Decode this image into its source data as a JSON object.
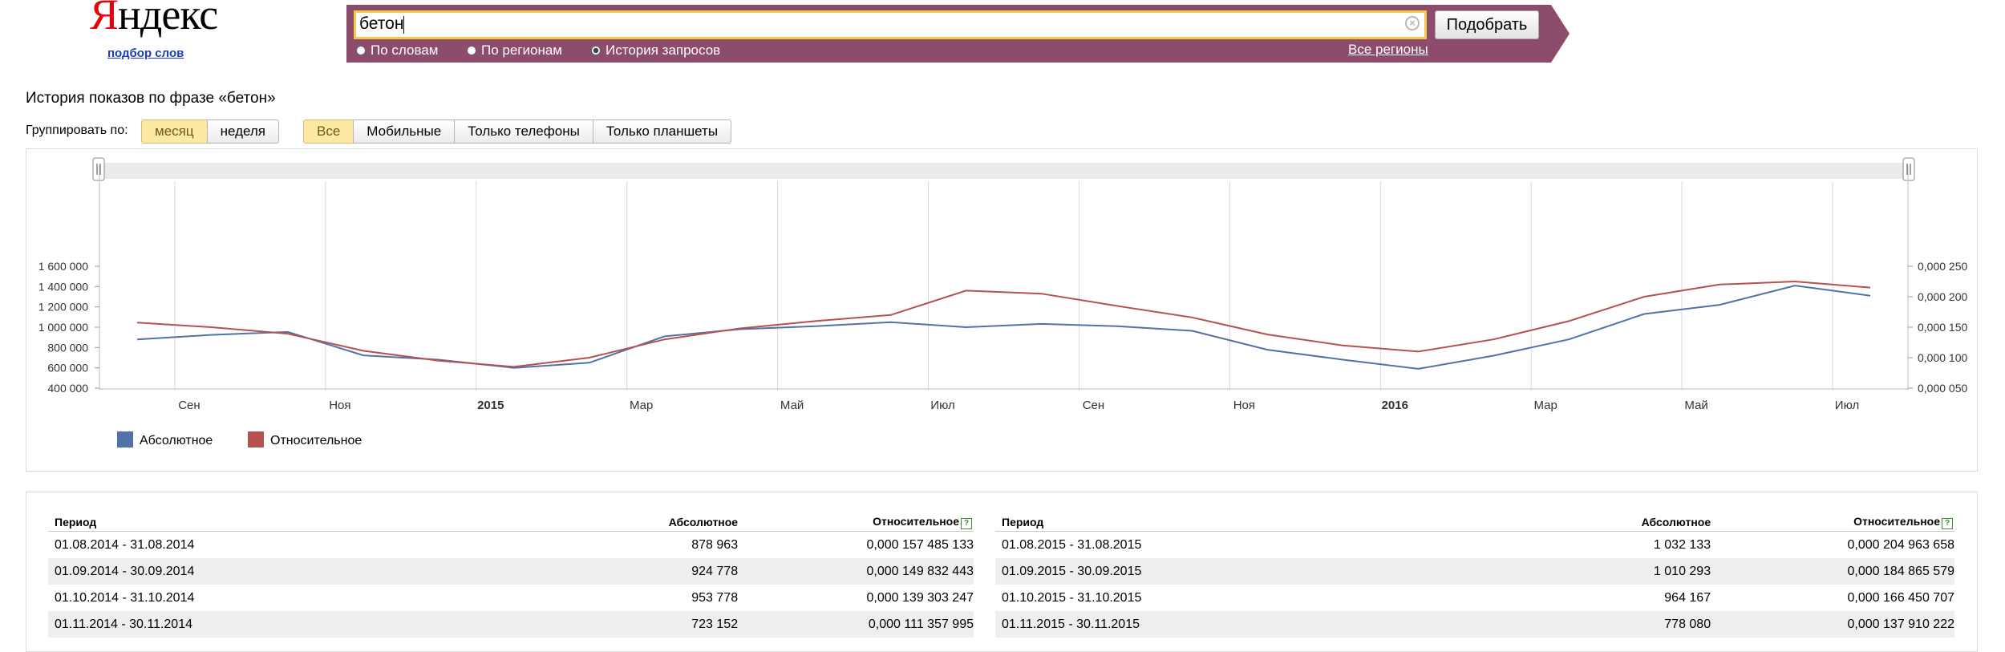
{
  "logo": {
    "text_first": "Я",
    "text_rest": "ндекс",
    "sub": "подбор слов"
  },
  "search": {
    "value": "бетон",
    "button": "Подобрать",
    "modes": [
      {
        "label": "По словам",
        "selected": false
      },
      {
        "label": "По регионам",
        "selected": false
      },
      {
        "label": "История запросов",
        "selected": true
      }
    ],
    "regions_link": "Все регионы"
  },
  "page_title": "История показов по фразе «бетон»",
  "grouping": {
    "label": "Группировать по:",
    "options": [
      "месяц",
      "неделя"
    ],
    "active": 0
  },
  "devices": {
    "options": [
      "Все",
      "Мобильные",
      "Только телефоны",
      "Только планшеты"
    ],
    "active": 0
  },
  "colors": {
    "absolute": "#4f73a6",
    "relative": "#b5524f",
    "accent": "#8e4c6c",
    "highlight": "#f3c94b"
  },
  "chart_data": {
    "type": "line",
    "x": [
      "2014-08",
      "2014-09",
      "2014-10",
      "2014-11",
      "2014-12",
      "2015-01",
      "2015-02",
      "2015-03",
      "2015-04",
      "2015-05",
      "2015-06",
      "2015-07",
      "2015-08",
      "2015-09",
      "2015-10",
      "2015-11",
      "2015-12",
      "2016-01",
      "2016-02",
      "2016-03",
      "2016-04",
      "2016-05",
      "2016-06",
      "2016-07"
    ],
    "x_tick_labels": [
      "Сен",
      "Ноя",
      "2015",
      "Мар",
      "Май",
      "Июл",
      "Сен",
      "Ноя",
      "2016",
      "Мар",
      "Май",
      "Июл"
    ],
    "y_left_ticks": [
      "400 000",
      "600 000",
      "800 000",
      "1 000 000",
      "1 200 000",
      "1 400 000",
      "1 600 000"
    ],
    "y_right_ticks": [
      "0,000 050",
      "0,000 100",
      "0,000 150",
      "0,000 200",
      "0,000 250"
    ],
    "ylim_left": [
      400000,
      1600000
    ],
    "ylim_right": [
      5e-05,
      0.00025
    ],
    "grid": "vertical",
    "legend_position": "bottom-left",
    "series": [
      {
        "name": "Абсолютное",
        "axis": "left",
        "values": [
          878963,
          924778,
          953778,
          723152,
          680000,
          600000,
          650000,
          910000,
          980000,
          1010000,
          1050000,
          1000000,
          1032133,
          1010293,
          964167,
          778080,
          680000,
          590000,
          720000,
          880000,
          1130000,
          1220000,
          1410000,
          1310000
        ]
      },
      {
        "name": "Относительное",
        "axis": "right",
        "values": [
          0.000157485,
          0.000149832,
          0.000139303,
          0.000111358,
          9.5e-05,
          8.5e-05,
          0.0001,
          0.00013,
          0.000148,
          0.00016,
          0.00017,
          0.00021,
          0.000205,
          0.000185,
          0.000166,
          0.000138,
          0.00012,
          0.00011,
          0.00013,
          0.00016,
          0.0002,
          0.00022,
          0.000225,
          0.000215
        ]
      }
    ]
  },
  "table": {
    "headers": {
      "period": "Период",
      "absolute": "Абсолютное",
      "relative": "Относительное",
      "help": "?"
    },
    "left": [
      {
        "period": "01.08.2014 - 31.08.2014",
        "absolute": "878 963",
        "relative": "0,000 157 485 133"
      },
      {
        "period": "01.09.2014 - 30.09.2014",
        "absolute": "924 778",
        "relative": "0,000 149 832 443"
      },
      {
        "period": "01.10.2014 - 31.10.2014",
        "absolute": "953 778",
        "relative": "0,000 139 303 247"
      },
      {
        "period": "01.11.2014 - 30.11.2014",
        "absolute": "723 152",
        "relative": "0,000 111 357 995"
      }
    ],
    "right": [
      {
        "period": "01.08.2015 - 31.08.2015",
        "absolute": "1 032 133",
        "relative": "0,000 204 963 658"
      },
      {
        "period": "01.09.2015 - 30.09.2015",
        "absolute": "1 010 293",
        "relative": "0,000 184 865 579"
      },
      {
        "period": "01.10.2015 - 31.10.2015",
        "absolute": "964 167",
        "relative": "0,000 166 450 707"
      },
      {
        "period": "01.11.2015 - 30.11.2015",
        "absolute": "778 080",
        "relative": "0,000 137 910 222"
      }
    ]
  }
}
